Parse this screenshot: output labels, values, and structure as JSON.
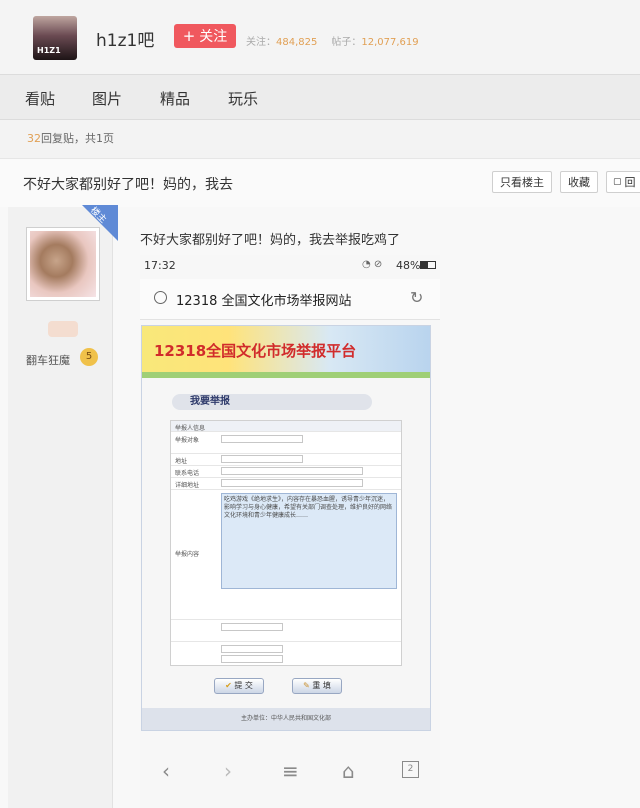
{
  "header": {
    "avatar_text": "H1Z1",
    "bar_name": "h1z1吧",
    "follow_label": "关注",
    "follow_plus": "+",
    "followers_label": "关注：",
    "followers_count": "484,825",
    "posts_label": "帖子：",
    "posts_count": "12,077,619"
  },
  "tabs": [
    "看贴",
    "图片",
    "精品",
    "玩乐"
  ],
  "meta": {
    "reply_count": "32",
    "reply_label": "回复贴，共1页"
  },
  "thread": {
    "title": "不好大家都别好了吧！妈的，我去",
    "btn_only_op": "只看楼主",
    "btn_favorite": "收藏",
    "btn_reply": "回"
  },
  "post": {
    "badge": "楼主",
    "username": "翻车狂魔",
    "level": "5",
    "text": "不好大家都别好了吧！妈的，我去举报吃鸡了"
  },
  "screenshot": {
    "time": "17:32",
    "battery": "48%",
    "site_title": "12318 全国文化市场举报网站",
    "banner": "12318全国文化市场举报平台",
    "section_title": "我要举报",
    "form_header": "举报人信息",
    "rows": [
      "举报对象",
      "地址",
      "联系电话",
      "详细地址",
      "举报内容"
    ],
    "complaint": "吃鸡游戏《绝地求生》，内容存在暴恐血腥，诱导青少年沉迷，影响学习与身心健康，希望有关部门调查处理，维护良好的网络文化环境和青少年健康成长……",
    "submit_label": "提 交",
    "reset_label": "重 填",
    "footer": "主办单位：中华人民共和国文化部"
  },
  "nav_icons": [
    "back-icon",
    "forward-icon",
    "menu-icon",
    "home-icon",
    "tabs-icon"
  ],
  "tabs_count": "2"
}
